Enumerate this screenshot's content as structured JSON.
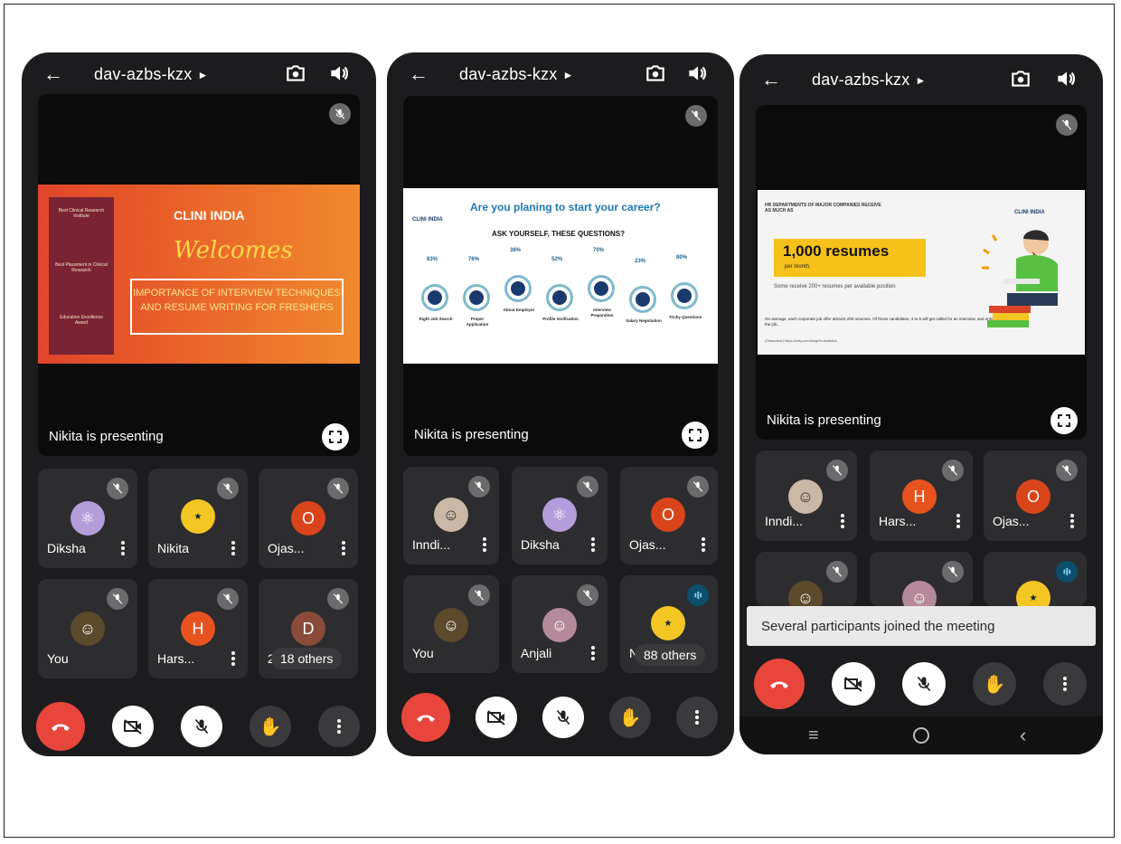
{
  "meeting_code": "dav-azbs-kzx",
  "presenting_text": "Nikita is presenting",
  "phone1": {
    "slide": {
      "logo": "CLINI INDIA",
      "welcome": "Welcomes",
      "topic": "IMPORTANCE OF INTERVIEW TECHNIQUES AND RESUME WRITING FOR FRESHERS",
      "awards": [
        "Best Clinical Research Institute",
        "Best Placement in Clinical Research",
        "Education Excellence Award"
      ]
    },
    "tiles": [
      {
        "name": "Diksha",
        "avatar": "atom-avatar"
      },
      {
        "name": "Nikita",
        "avatar": "badge-avatar"
      },
      {
        "name": "Ojas...",
        "initial": "O"
      },
      {
        "name": "You",
        "avatar": "photo-avatar"
      },
      {
        "name": "Hars...",
        "initial": "H"
      },
      {
        "name": "21",
        "initial": "D",
        "others": "18 others"
      }
    ]
  },
  "phone2": {
    "slide": {
      "logo": "CLINI INDIA",
      "title": "Are you planing to start your career?",
      "subtitle": "ASK YOURSELF, THESE QUESTIONS?",
      "items": [
        {
          "pct": "83%",
          "label": "Right Job Search"
        },
        {
          "pct": "76%",
          "label": "Proper Application"
        },
        {
          "pct": "38%",
          "label": "About Employer"
        },
        {
          "pct": "52%",
          "label": "Profile Verification"
        },
        {
          "pct": "70%",
          "label": "Interview Preparation"
        },
        {
          "pct": "23%",
          "label": "Salary Negotiation"
        },
        {
          "pct": "80%",
          "label": "Tricky Questions"
        }
      ]
    },
    "tiles": [
      {
        "name": "Inndi...",
        "avatar": "photo-avatar"
      },
      {
        "name": "Diksha",
        "avatar": "atom-avatar"
      },
      {
        "name": "Ojas...",
        "initial": "O"
      },
      {
        "name": "You",
        "avatar": "photo-avatar"
      },
      {
        "name": "Anjali",
        "avatar": "photo-avatar"
      },
      {
        "name": "N",
        "avatar": "badge-avatar",
        "others": "88 others"
      }
    ]
  },
  "phone3": {
    "slide": {
      "header": "HR DEPARTMENTS OF MAJOR COMPANIES RECEIVE AS MUCH AS",
      "logo": "CLINI INDIA",
      "big": "1,000 resumes",
      "per": "per month.",
      "sub": "Some receive 200+ resumes per available position",
      "footnote": "On average, each corporate job offer attracts 250 resumes. Of those candidates, 4 to 6 will get called for an interview, and only one will get the job.",
      "source": "(Glassdoor) https://zety.com/blog/hr-statistics"
    },
    "tiles": [
      {
        "name": "Inndi...",
        "avatar": "photo-avatar"
      },
      {
        "name": "Hars...",
        "initial": "H"
      },
      {
        "name": "Ojas...",
        "initial": "O"
      }
    ],
    "toast": "Several participants joined the meeting"
  },
  "colors": {
    "end_call": "#e8453c",
    "orange_avatar": "#e8521e",
    "brown_avatar": "#8a4b3a"
  }
}
